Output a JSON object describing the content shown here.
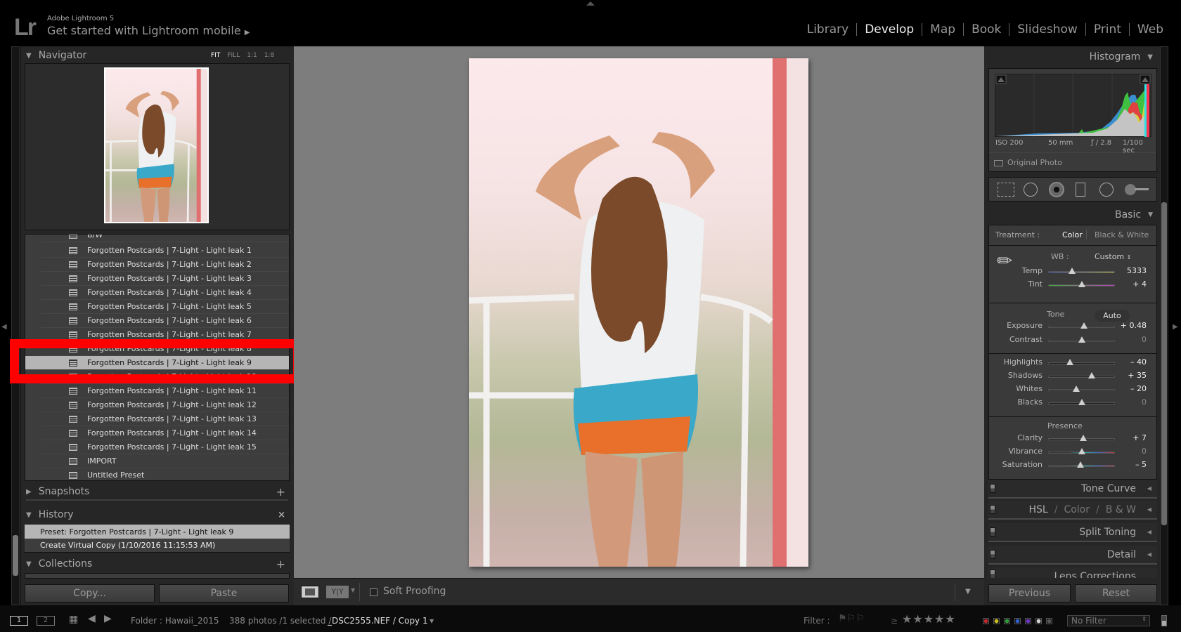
{
  "app": {
    "product": "Adobe Lightroom 5",
    "logo": "Lr",
    "promo": "Get started with Lightroom mobile",
    "promo_icon": "play-triangle-icon"
  },
  "modules": [
    {
      "label": "Library",
      "active": false
    },
    {
      "label": "Develop",
      "active": true
    },
    {
      "label": "Map",
      "active": false
    },
    {
      "label": "Book",
      "active": false
    },
    {
      "label": "Slideshow",
      "active": false
    },
    {
      "label": "Print",
      "active": false
    },
    {
      "label": "Web",
      "active": false
    }
  ],
  "left": {
    "navigator": {
      "title": "Navigator",
      "options": [
        "FIT",
        "FILL",
        "1:1",
        "1:8"
      ],
      "active_option": "FIT"
    },
    "presets": {
      "partial_top": "B/W",
      "items": [
        "Forgotten Postcards | 7-Light - Light leak 1",
        "Forgotten Postcards | 7-Light - Light leak 2",
        "Forgotten Postcards | 7-Light - Light leak 3",
        "Forgotten Postcards | 7-Light - Light leak 4",
        "Forgotten Postcards | 7-Light - Light leak 5",
        "Forgotten Postcards | 7-Light - Light leak 6",
        "Forgotten Postcards | 7-Light - Light leak 7",
        "Forgotten Postcards | 7-Light - Light leak 8",
        "Forgotten Postcards | 7-Light - Light leak 9",
        "Forgotten Postcards | 7-Light - Light leak 10",
        "Forgotten Postcards | 7-Light - Light leak 11",
        "Forgotten Postcards | 7-Light - Light leak 12",
        "Forgotten Postcards | 7-Light - Light leak 13",
        "Forgotten Postcards | 7-Light - Light leak 14",
        "Forgotten Postcards | 7-Light - Light leak 15",
        "IMPORT",
        "Untitled Preset"
      ],
      "selected": "Forgotten Postcards | 7-Light - Light leak 9",
      "highlight_color": "#ff0000"
    },
    "snapshots": {
      "title": "Snapshots"
    },
    "history": {
      "title": "History",
      "items": [
        "Preset: Forgotten Postcards | 7-Light - Light leak 9",
        "Create Virtual Copy (1/10/2016 11:15:53 AM)"
      ]
    },
    "collections": {
      "title": "Collections"
    },
    "copy_label": "Copy...",
    "paste_label": "Paste"
  },
  "toolbar": {
    "soft_proofing": "Soft Proofing",
    "soft_proofing_checked": false
  },
  "right": {
    "histogram": {
      "title": "Histogram",
      "iso": "ISO 200",
      "focal": "50 mm",
      "aperture": "ƒ / 2.8",
      "shutter": "1/100 sec",
      "original_photo": "Original Photo"
    },
    "tools": [
      "crop-overlay-icon",
      "spot-removal-icon",
      "red-eye-icon",
      "graduated-filter-icon",
      "radial-filter-icon",
      "adjustment-brush-icon"
    ],
    "basic": {
      "title": "Basic",
      "treatment_label": "Treatment :",
      "treatment_color": "Color",
      "treatment_bw": "Black & White",
      "wb_label": "WB :",
      "wb_value": "Custom",
      "tone_label": "Tone",
      "auto_label": "Auto",
      "presence_label": "Presence",
      "sliders": [
        {
          "label": "Temp",
          "value": "5333",
          "level": 0.35
        },
        {
          "label": "Tint",
          "value": "+ 4",
          "level": 0.51
        },
        {
          "label": "Exposure",
          "value": "+ 0.48",
          "level": 0.54
        },
        {
          "label": "Contrast",
          "value": "0",
          "level": 0.5
        },
        {
          "label": "Highlights",
          "value": "– 40",
          "level": 0.32
        },
        {
          "label": "Shadows",
          "value": "+ 35",
          "level": 0.66
        },
        {
          "label": "Whites",
          "value": "– 20",
          "level": 0.42
        },
        {
          "label": "Blacks",
          "value": "0",
          "level": 0.5
        },
        {
          "label": "Clarity",
          "value": "+ 7",
          "level": 0.53
        },
        {
          "label": "Vibrance",
          "value": "0",
          "level": 0.5
        },
        {
          "label": "Saturation",
          "value": "– 5",
          "level": 0.48
        }
      ]
    },
    "panels": {
      "tone_curve": "Tone Curve",
      "hsl": "HSL",
      "color": "Color",
      "bw": "B & W",
      "split_toning": "Split Toning",
      "detail": "Detail",
      "lens": "Lens Corrections"
    },
    "previous_label": "Previous",
    "reset_label": "Reset"
  },
  "filmstrip": {
    "screen1": "1",
    "screen2": "2",
    "folder": "Folder : Hawaii_2015",
    "count": "388 photos /1 selected /",
    "file": "_DSC2555.NEF / Copy 1",
    "filter_label": "Filter :",
    "gte": "≥",
    "filter_value": "No Filter",
    "label_colors": [
      "#c0282d",
      "#c7bd1e",
      "#2e9a3a",
      "#2f5fc4",
      "#6a35c6",
      "#d0d0d0",
      "#555555"
    ]
  }
}
